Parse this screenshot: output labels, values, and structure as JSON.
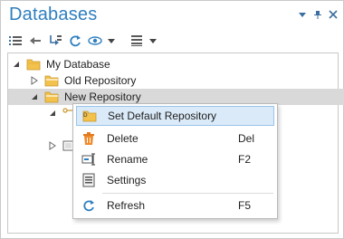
{
  "panel": {
    "title": "Databases",
    "title_actions": [
      "dropdown-arrow-icon",
      "pin-icon",
      "close-icon"
    ]
  },
  "toolbar": {
    "icons": [
      "list-icon",
      "back-arrow-icon",
      "indent-icon",
      "refresh-icon",
      "view-icon",
      "view-dropdown-icon",
      "layout-icon",
      "layout-dropdown-icon"
    ]
  },
  "tree": {
    "root_label": "My Database",
    "items": [
      {
        "label": "Old Repository"
      },
      {
        "label": "New Repository"
      }
    ]
  },
  "context_menu": {
    "items": [
      {
        "label": "Set Default Repository",
        "shortcut": "",
        "icon": "folder-default-icon"
      },
      {
        "label": "Delete",
        "shortcut": "Del",
        "icon": "trash-icon"
      },
      {
        "label": "Rename",
        "shortcut": "F2",
        "icon": "rename-icon"
      },
      {
        "label": "Settings",
        "shortcut": "",
        "icon": "settings-icon"
      },
      {
        "label": "Refresh",
        "shortcut": "F5",
        "icon": "refresh-icon"
      }
    ]
  },
  "colors": {
    "title": "#2f7fbf",
    "folder": "#f2c24c",
    "highlight": "#dbeaf8",
    "selection": "#d9d9d9"
  }
}
